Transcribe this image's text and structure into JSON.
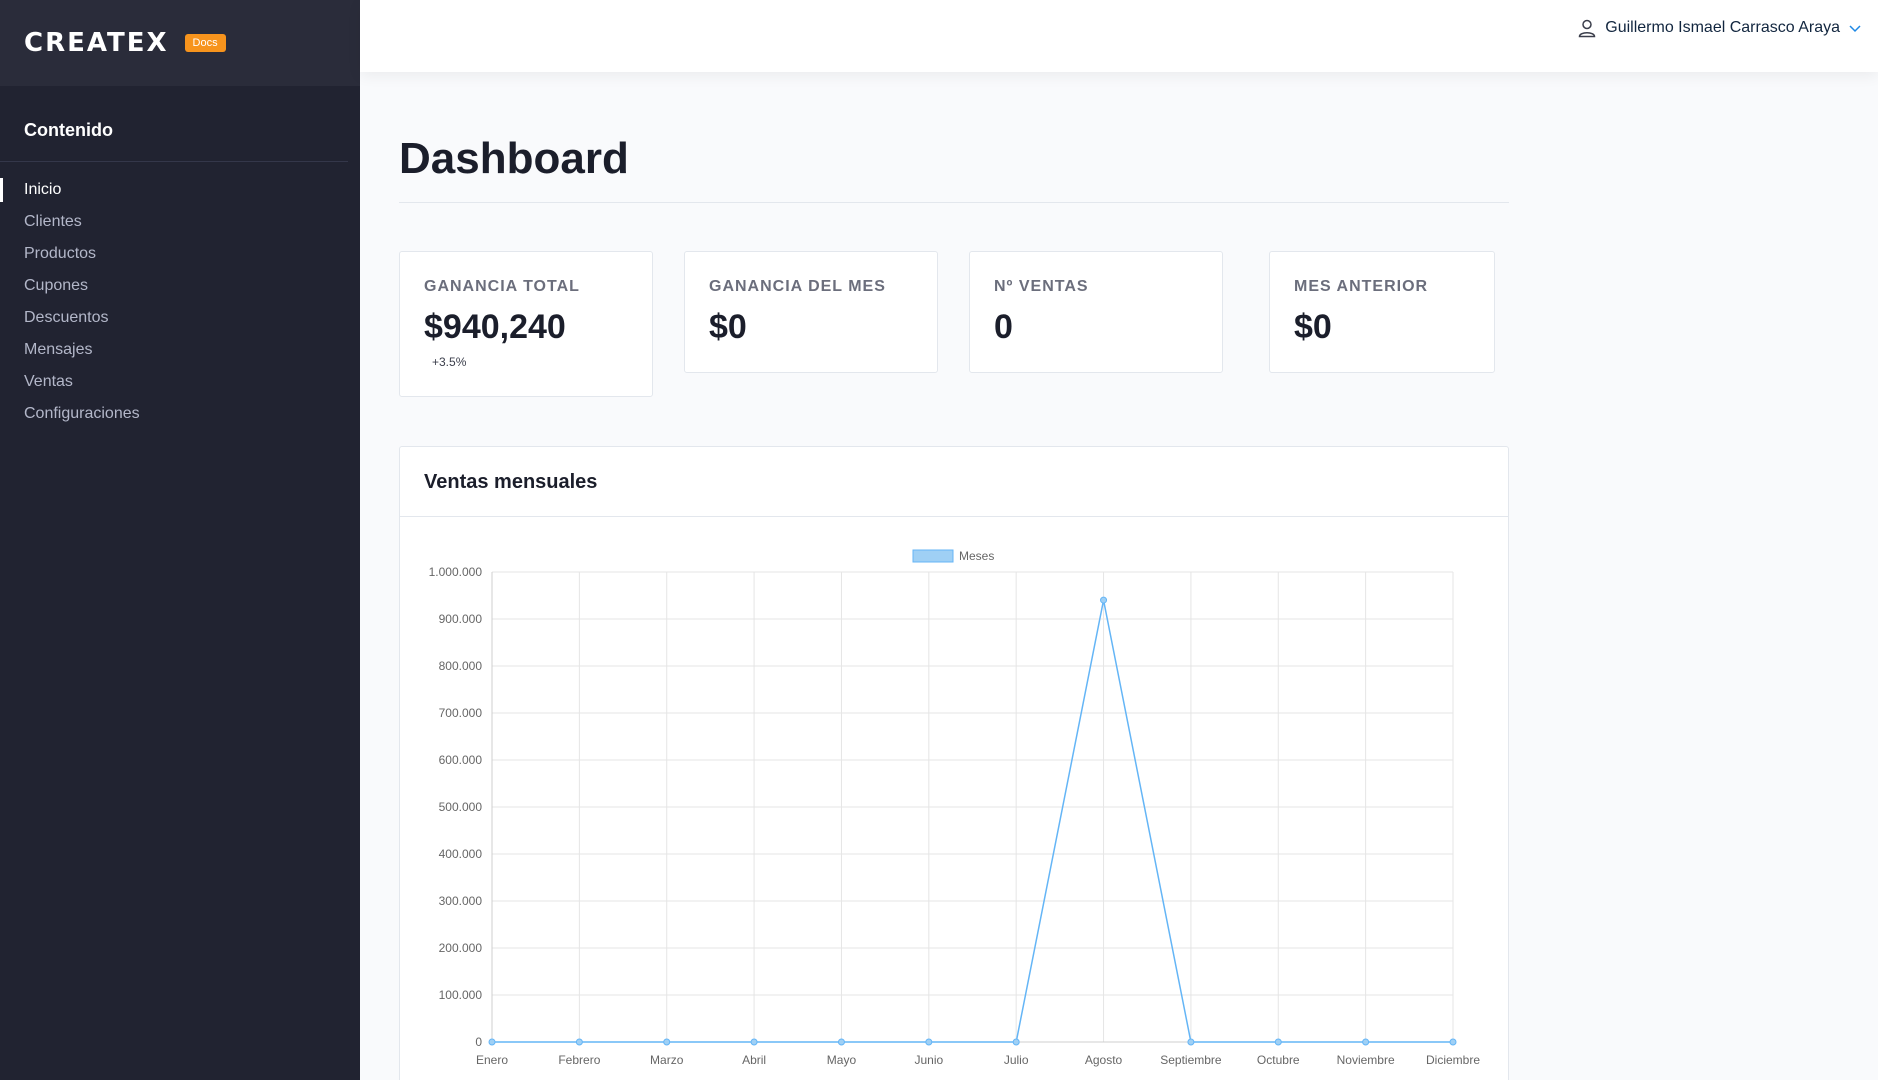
{
  "brand": {
    "logo": "CREATEX",
    "badge": "Docs"
  },
  "sidebar": {
    "heading": "Contenido",
    "items": [
      {
        "label": "Inicio"
      },
      {
        "label": "Clientes"
      },
      {
        "label": "Productos"
      },
      {
        "label": "Cupones"
      },
      {
        "label": "Descuentos"
      },
      {
        "label": "Mensajes"
      },
      {
        "label": "Ventas"
      },
      {
        "label": "Configuraciones"
      }
    ],
    "active": "Inicio"
  },
  "header": {
    "user_name": "Guillermo Ismael Carrasco Araya"
  },
  "page": {
    "title": "Dashboard"
  },
  "cards": [
    {
      "label": "GANANCIA TOTAL",
      "value": "$940,240",
      "delta": "+3.5%"
    },
    {
      "label": "GANANCIA DEL MES",
      "value": "$0"
    },
    {
      "label": "Nº VENTAS",
      "value": "0"
    },
    {
      "label": "MES ANTERIOR",
      "value": "$0"
    }
  ],
  "panel": {
    "title": "Ventas mensuales"
  },
  "colors": {
    "line": "#64b5f6",
    "legend_fill": "#9fd0f5",
    "sidebar_bg": "#212331",
    "badge": "#f7941d"
  },
  "chart_data": {
    "type": "line",
    "categories": [
      "Enero",
      "Febrero",
      "Marzo",
      "Abril",
      "Mayo",
      "Junio",
      "Julio",
      "Agosto",
      "Septiembre",
      "Octubre",
      "Noviembre",
      "Diciembre"
    ],
    "series": [
      {
        "name": "Meses",
        "values": [
          0,
          0,
          0,
          0,
          0,
          0,
          0,
          940240,
          0,
          0,
          0,
          0
        ]
      }
    ],
    "ylim": [
      0,
      1000000
    ],
    "yticks": [
      "0",
      "100.000",
      "200.000",
      "300.000",
      "400.000",
      "500.000",
      "600.000",
      "700.000",
      "800.000",
      "900.000",
      "1.000.000"
    ],
    "grid": true,
    "legend": "top-center"
  }
}
